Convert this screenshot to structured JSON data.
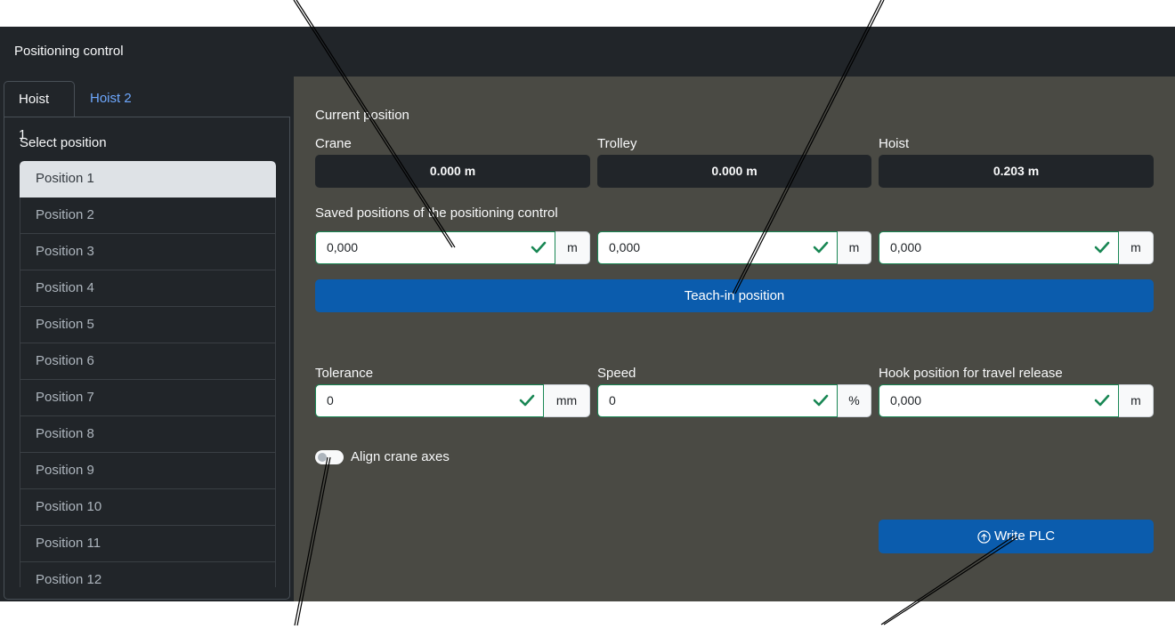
{
  "window": {
    "title": "Positioning control"
  },
  "tabs": [
    {
      "label": "Hoist 1",
      "active": true
    },
    {
      "label": "Hoist 2",
      "active": false
    }
  ],
  "sidebar": {
    "heading": "Select position",
    "items": [
      "Position 1",
      "Position 2",
      "Position 3",
      "Position 4",
      "Position 5",
      "Position 6",
      "Position 7",
      "Position 8",
      "Position 9",
      "Position 10",
      "Position 11",
      "Position 12"
    ],
    "selected": "Position 1"
  },
  "current": {
    "heading": "Current position",
    "crane": {
      "label": "Crane",
      "value": "0.000 m"
    },
    "trolley": {
      "label": "Trolley",
      "value": "0.000 m"
    },
    "hoist": {
      "label": "Hoist",
      "value": "0.203 m"
    }
  },
  "saved": {
    "heading": "Saved positions of the positioning control",
    "crane": {
      "value": "0,000",
      "unit": "m"
    },
    "trolley": {
      "value": "0,000",
      "unit": "m"
    },
    "hoist": {
      "value": "0,000",
      "unit": "m"
    }
  },
  "teach_button": "Teach-in position",
  "params": {
    "tolerance": {
      "label": "Tolerance",
      "value": "0",
      "unit": "mm"
    },
    "speed": {
      "label": "Speed",
      "value": "0",
      "unit": "%"
    },
    "hook": {
      "label": "Hook position for travel release",
      "value": "0,000",
      "unit": "m"
    }
  },
  "align": {
    "label": "Align crane axes",
    "enabled": false
  },
  "write_button": "Write PLC",
  "colors": {
    "accent": "#0b5cad",
    "valid": "#198754",
    "tab_link": "#6ea8fe"
  },
  "icons": [
    "check-icon",
    "upload-circle-icon"
  ]
}
